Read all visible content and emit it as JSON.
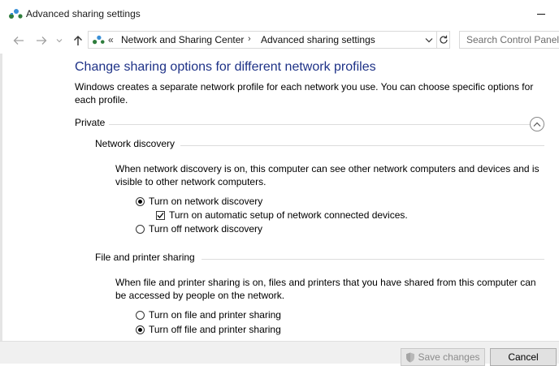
{
  "window": {
    "title": "Advanced sharing settings",
    "icon": "network-sharing-icon"
  },
  "navigation": {
    "breadcrumb_overflow": "«",
    "breadcrumbs": [
      "Network and Sharing Center",
      "Advanced sharing settings"
    ],
    "breadcrumb_separator": "›",
    "search_placeholder": "Search Control Panel"
  },
  "main": {
    "heading": "Change sharing options for different network profiles",
    "intro": "Windows creates a separate network profile for each network you use. You can choose specific options for each profile.",
    "profile": {
      "name": "Private",
      "expanded": true,
      "sections": [
        {
          "title": "Network discovery",
          "description": "When network discovery is on, this computer can see other network computers and devices and is visible to other network computers.",
          "options": [
            {
              "label": "Turn on network discovery",
              "type": "radio",
              "selected": true
            },
            {
              "label": "Turn on automatic setup of network connected devices.",
              "type": "checkbox",
              "checked": true
            },
            {
              "label": "Turn off network discovery",
              "type": "radio",
              "selected": false
            }
          ]
        },
        {
          "title": "File and printer sharing",
          "description": "When file and printer sharing is on, files and printers that you have shared from this computer can be accessed by people on the network.",
          "options": [
            {
              "label": "Turn on file and printer sharing",
              "type": "radio",
              "selected": false
            },
            {
              "label": "Turn off file and printer sharing",
              "type": "radio",
              "selected": true
            }
          ]
        }
      ]
    }
  },
  "footer": {
    "save_label": "Save changes",
    "save_enabled": false,
    "cancel_label": "Cancel"
  },
  "colors": {
    "heading": "#1e3287",
    "accent_icon": "#2b7a3d"
  }
}
